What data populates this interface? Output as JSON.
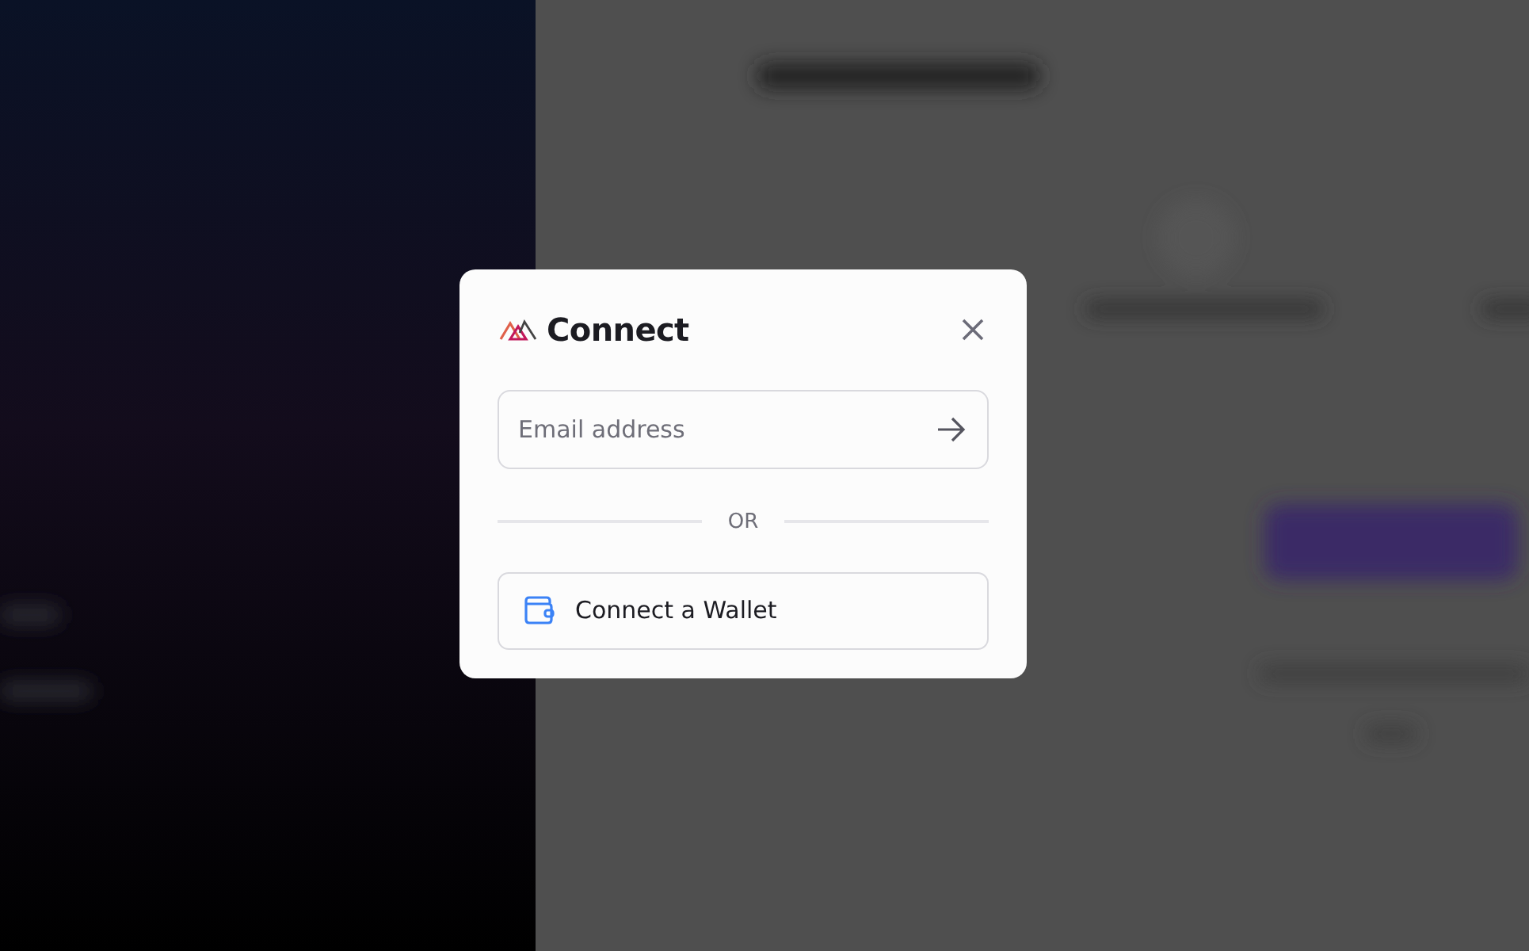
{
  "dialog": {
    "title": "Connect",
    "email": {
      "placeholder": "Email address"
    },
    "divider": "OR",
    "wallet_button": "Connect a Wallet"
  }
}
